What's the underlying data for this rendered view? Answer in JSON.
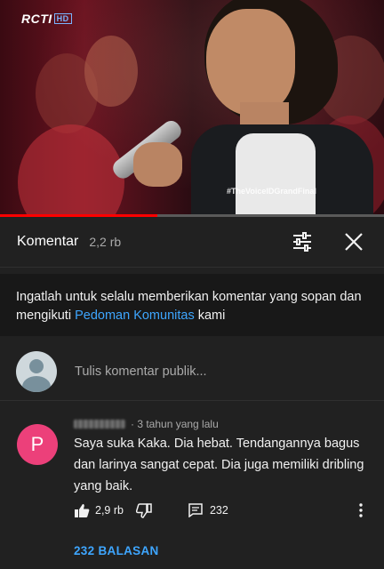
{
  "video": {
    "channel_logo": "RCTI",
    "channel_logo_badge": "HD",
    "hashtag": "#TheVoiceIDGrandFinal",
    "progress": 0.41,
    "progress_color": "#ff0000"
  },
  "comments_panel": {
    "title": "Komentar",
    "count": "2,2 rb",
    "filter_icon": "sliders-icon",
    "close_icon": "close-icon"
  },
  "notice": {
    "text_before": "Ingatlah untuk selalu memberikan komentar yang sopan dan mengikuti ",
    "link": "Pedoman Komunitas",
    "text_after": " kami"
  },
  "add_comment": {
    "placeholder": "Tulis komentar publik..."
  },
  "comment": {
    "avatar_letter": "P",
    "avatar_color": "#ec407a",
    "time": "· 3 tahun yang lalu",
    "text": "Saya suka Kaka. Dia hebat. Tendangannya bagus dan larinya sangat cepat. Dia juga memiliki dribling yang baik.",
    "likes": "2,9 rb",
    "replies": "232",
    "replies_link": "232 BALASAN"
  },
  "colors": {
    "background": "#212121",
    "link": "#3ea6ff"
  }
}
